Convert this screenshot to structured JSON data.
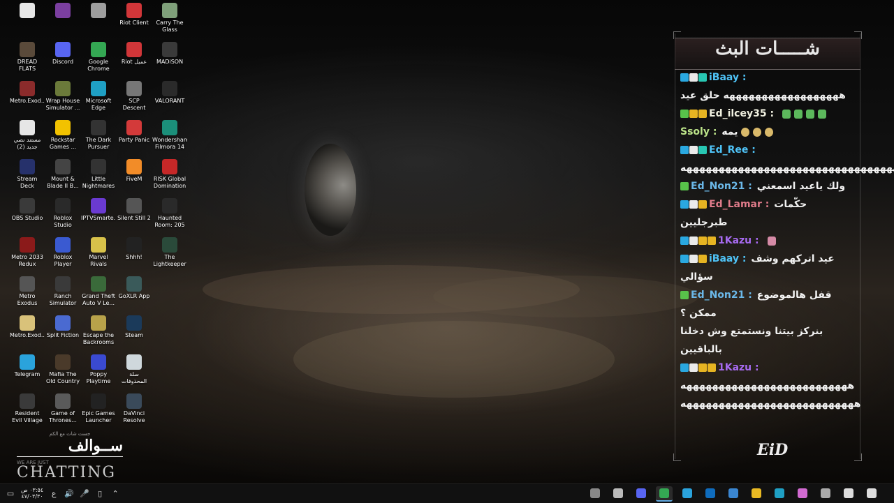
{
  "desktop": {
    "icons": [
      {
        "label": "",
        "icon": "document-icon",
        "color": "#e6e6e6",
        "col": 0,
        "row": 0
      },
      {
        "label": "",
        "icon": "winrar-icon",
        "color": "#7b3fa0",
        "col": 1,
        "row": 0
      },
      {
        "label": "",
        "icon": "shortcut-icon",
        "color": "#9e9e9e",
        "col": 2,
        "row": 0
      },
      {
        "label": "Riot Client",
        "icon": "riot-icon",
        "color": "#d13639",
        "col": 3,
        "row": 0
      },
      {
        "label": "Carry The Glass",
        "icon": "game-icon",
        "color": "#7fa07a",
        "col": 4,
        "row": 0
      },
      {
        "label": "DREAD FLATS",
        "icon": "game-icon",
        "color": "#5a4a3a",
        "col": 0,
        "row": 1
      },
      {
        "label": "Discord",
        "icon": "discord-icon",
        "color": "#5865f2",
        "col": 1,
        "row": 1
      },
      {
        "label": "Google Chrome",
        "icon": "chrome-icon",
        "color": "#34a853",
        "col": 2,
        "row": 1
      },
      {
        "label": "Riot عميل",
        "icon": "riot-icon",
        "color": "#d13639",
        "col": 3,
        "row": 1
      },
      {
        "label": "MADiSON",
        "icon": "game-icon",
        "color": "#3a3a3a",
        "col": 4,
        "row": 1
      },
      {
        "label": "Metro.Exod...",
        "icon": "winrar-icon",
        "color": "#8b2b2b",
        "col": 0,
        "row": 2
      },
      {
        "label": "Wrap House Simulator ...",
        "icon": "game-icon",
        "color": "#6b7a3a",
        "col": 1,
        "row": 2
      },
      {
        "label": "Microsoft Edge",
        "icon": "edge-icon",
        "color": "#1fa0c4",
        "col": 2,
        "row": 2
      },
      {
        "label": "SCP Descent",
        "icon": "game-icon",
        "color": "#777777",
        "col": 3,
        "row": 2
      },
      {
        "label": "VALORANT",
        "icon": "valorant-icon",
        "color": "#2a2a2a",
        "col": 4,
        "row": 2
      },
      {
        "label": "مستند نصي جديد (2)",
        "icon": "document-icon",
        "color": "#e6e6e6",
        "col": 0,
        "row": 3
      },
      {
        "label": "Rockstar Games ...",
        "icon": "rockstar-icon",
        "color": "#f2c200",
        "col": 1,
        "row": 3
      },
      {
        "label": "The Dark Pursuer",
        "icon": "game-icon",
        "color": "#333333",
        "col": 2,
        "row": 3
      },
      {
        "label": "Party Panic",
        "icon": "game-icon",
        "color": "#d33a3a",
        "col": 3,
        "row": 3
      },
      {
        "label": "Wondershare Filmora 14",
        "icon": "filmora-icon",
        "color": "#1b8f7a",
        "col": 4,
        "row": 3
      },
      {
        "label": "Stream Deck",
        "icon": "streamdeck-icon",
        "color": "#26316b",
        "col": 0,
        "row": 4
      },
      {
        "label": "Mount & Blade II B...",
        "icon": "game-icon",
        "color": "#444444",
        "col": 1,
        "row": 4
      },
      {
        "label": "Little Nightmares",
        "icon": "game-icon",
        "color": "#333333",
        "col": 2,
        "row": 4
      },
      {
        "label": "FiveM",
        "icon": "fivem-icon",
        "color": "#f28c28",
        "col": 3,
        "row": 4
      },
      {
        "label": "RISK Global Domination",
        "icon": "game-icon",
        "color": "#c62828",
        "col": 4,
        "row": 4
      },
      {
        "label": "OBS Studio",
        "icon": "obs-icon",
        "color": "#3a3a3a",
        "col": 0,
        "row": 5
      },
      {
        "label": "Roblox Studio",
        "icon": "roblox-icon",
        "color": "#2a2a2a",
        "col": 1,
        "row": 5
      },
      {
        "label": "IPTVSmarte...",
        "icon": "tv-icon",
        "color": "#6a3ad1",
        "col": 2,
        "row": 5
      },
      {
        "label": "Silent Still 2",
        "icon": "game-icon",
        "color": "#555555",
        "col": 3,
        "row": 5
      },
      {
        "label": "Haunted Room: 205",
        "icon": "game-icon",
        "color": "#2a2a2a",
        "col": 4,
        "row": 5
      },
      {
        "label": "Metro 2033 Redux",
        "icon": "game-icon",
        "color": "#8b1a1a",
        "col": 0,
        "row": 6
      },
      {
        "label": "Roblox Player",
        "icon": "roblox-icon",
        "color": "#3a5ad1",
        "col": 1,
        "row": 6
      },
      {
        "label": "Marvel Rivals",
        "icon": "game-icon",
        "color": "#d8c24a",
        "col": 2,
        "row": 6
      },
      {
        "label": "Shhh!",
        "icon": "game-icon",
        "color": "#222222",
        "col": 3,
        "row": 6
      },
      {
        "label": "The Lightkeeper",
        "icon": "game-icon",
        "color": "#2a4a3a",
        "col": 4,
        "row": 6
      },
      {
        "label": "Metro Exodus",
        "icon": "game-icon",
        "color": "#555555",
        "col": 0,
        "row": 7
      },
      {
        "label": "Ranch Simulator",
        "icon": "game-icon",
        "color": "#3a3a3a",
        "col": 1,
        "row": 7
      },
      {
        "label": "Grand Theft Auto V Le...",
        "icon": "gta-icon",
        "color": "#3a6a3a",
        "col": 2,
        "row": 7
      },
      {
        "label": "GoXLR App",
        "icon": "goxlr-icon",
        "color": "#3a5a5a",
        "col": 3,
        "row": 7
      },
      {
        "label": "Metro.Exod...",
        "icon": "document-icon",
        "color": "#d9c27a",
        "col": 0,
        "row": 8
      },
      {
        "label": "Split Fiction",
        "icon": "game-icon",
        "color": "#4a6ad1",
        "col": 1,
        "row": 8
      },
      {
        "label": "Escape the Backrooms",
        "icon": "game-icon",
        "color": "#b8a24a",
        "col": 2,
        "row": 8
      },
      {
        "label": "Steam",
        "icon": "steam-icon",
        "color": "#1b3a5a",
        "col": 3,
        "row": 8
      },
      {
        "label": "Telegram",
        "icon": "telegram-icon",
        "color": "#2aa3dc",
        "col": 0,
        "row": 9
      },
      {
        "label": "Mafia The Old Country",
        "icon": "game-icon",
        "color": "#4a3a2a",
        "col": 1,
        "row": 9
      },
      {
        "label": "Poppy Playtime",
        "icon": "game-icon",
        "color": "#3a4ad1",
        "col": 2,
        "row": 9
      },
      {
        "label": "سلة المحذوفات",
        "icon": "recycle-bin-icon",
        "color": "#cfd8dc",
        "col": 3,
        "row": 9
      },
      {
        "label": "Resident Evil Village",
        "icon": "game-icon",
        "color": "#3a3a3a",
        "col": 0,
        "row": 10
      },
      {
        "label": "Game of Thrones...",
        "icon": "game-icon",
        "color": "#5a5a5a",
        "col": 1,
        "row": 10
      },
      {
        "label": "Epic Games Launcher",
        "icon": "epic-icon",
        "color": "#222222",
        "col": 2,
        "row": 10
      },
      {
        "label": "DaVinci Resolve",
        "icon": "davinci-icon",
        "color": "#3a4a5a",
        "col": 3,
        "row": 10
      }
    ]
  },
  "logo": {
    "small": "جست شات مع الكم",
    "arabic": "ســوالف",
    "tagline": "WE ARE JUST",
    "chatting": "CHATTING"
  },
  "chat": {
    "title": "شـــــات البث",
    "footer_logo": "EiD",
    "messages": [
      {
        "user": "iBaay",
        "user_class": "u-ibaay",
        "text": "",
        "badges": [
          "b-blue",
          "b-white",
          "b-teal"
        ],
        "emotes": []
      },
      {
        "user": "",
        "user_class": "u-ibaay",
        "text": "ههههههههههههههههههه حلق عيد",
        "badges": [],
        "emotes": []
      },
      {
        "user": "Ed_ilcey35",
        "user_class": "u-ilcey",
        "text": "",
        "badges": [
          "b-green",
          "b-gold",
          "b-gold"
        ],
        "emotes": [
          "e",
          "e",
          "e",
          "e"
        ]
      },
      {
        "user": "Ssoly",
        "user_class": "u-ssoly",
        "text": "يمه",
        "badges": [],
        "emotes": [
          "face",
          "face",
          "face"
        ]
      },
      {
        "user": "Ed_Ree",
        "user_class": "u-ree",
        "text": "",
        "badges": [
          "b-blue",
          "b-white",
          "b-teal"
        ],
        "emotes": []
      },
      {
        "user": "",
        "user_class": "u-ree",
        "text": "ههههههههههههههههههههههههههههههههههههه",
        "badges": [],
        "emotes": []
      },
      {
        "user": "Ed_Non21",
        "user_class": "u-non",
        "text": "ولك ياعيد اسمعني",
        "badges": [
          "b-green"
        ],
        "emotes": []
      },
      {
        "user": "Ed_Lamar",
        "user_class": "u-lamar",
        "text": "حكّمات طبرجليين",
        "badges": [
          "b-blue",
          "b-white",
          "b-gold"
        ],
        "emotes": []
      },
      {
        "user": "1Kazu",
        "user_class": "u-kazu",
        "text": "",
        "badges": [
          "b-blue",
          "b-white",
          "b-gold",
          "b-gold"
        ],
        "emotes": [
          "pink"
        ]
      },
      {
        "user": "iBaay",
        "user_class": "u-ibaay",
        "text": "عيد اتركهم وشف سؤالي",
        "badges": [
          "b-blue",
          "b-white",
          "b-gold"
        ],
        "emotes": []
      },
      {
        "user": "Ed_Non21",
        "user_class": "u-non",
        "text": "قفل هالموضوع ممكن ؟",
        "badges": [
          "b-green"
        ],
        "emotes": []
      },
      {
        "user": "",
        "user_class": "u-non",
        "text": "بنركز بيتنا ونستمتع وش دخلنا بالباقيين",
        "badges": [],
        "emotes": []
      },
      {
        "user": "1Kazu",
        "user_class": "u-kazu",
        "text": "",
        "badges": [
          "b-blue",
          "b-white",
          "b-gold",
          "b-gold"
        ],
        "emotes": []
      },
      {
        "user": "",
        "user_class": "u-kazu",
        "text": "ههههههههههههههههههههههههههه",
        "badges": [],
        "emotes": []
      },
      {
        "user": "",
        "user_class": "u-kazu",
        "text": "هههههههههههههههههههههههههههه",
        "badges": [],
        "emotes": []
      }
    ]
  },
  "taskbar": {
    "clock_time": "٠٣:٥٤ ص",
    "clock_date": "٤٧/٠٣/٣٠",
    "lang": "ع",
    "apps": [
      {
        "name": "task-view-icon",
        "color": "#888888",
        "active": false
      },
      {
        "name": "obs-icon",
        "color": "#bbbbbb",
        "active": false
      },
      {
        "name": "discord-icon",
        "color": "#5865f2",
        "active": false
      },
      {
        "name": "chrome-icon",
        "color": "#34a853",
        "active": true
      },
      {
        "name": "telegram-icon",
        "color": "#2aa3dc",
        "active": false
      },
      {
        "name": "outlook-icon",
        "color": "#0f6cbd",
        "active": false
      },
      {
        "name": "store-icon",
        "color": "#3a86d1",
        "active": false
      },
      {
        "name": "file-explorer-icon",
        "color": "#e8b923",
        "active": false
      },
      {
        "name": "edge-icon",
        "color": "#1fa0c4",
        "active": false
      },
      {
        "name": "copilot-icon",
        "color": "#d16ad1",
        "active": false
      },
      {
        "name": "widgets-icon",
        "color": "#aaaaaa",
        "active": false
      },
      {
        "name": "search-icon",
        "color": "#dddddd",
        "active": false
      },
      {
        "name": "start-icon",
        "color": "#dddddd",
        "active": false
      }
    ]
  }
}
